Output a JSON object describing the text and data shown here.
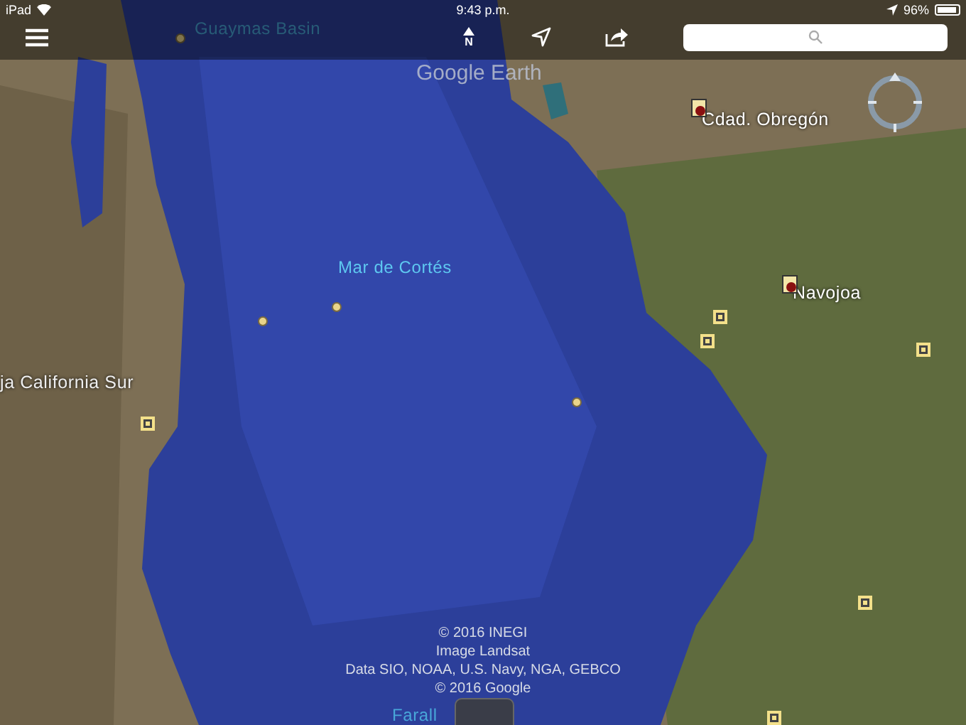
{
  "status_bar": {
    "device": "iPad",
    "time": "9:43 p.m.",
    "battery": "96%"
  },
  "toolbar": {
    "compass_letter": "N"
  },
  "map": {
    "logo": "Google Earth",
    "labels": [
      {
        "kind": "undersea",
        "text": "Guaymas Basin"
      },
      {
        "kind": "city",
        "text": "Cdad. Obregón"
      },
      {
        "kind": "city",
        "text": "Navojoa"
      },
      {
        "kind": "sea",
        "text": "Mar de Cortés"
      },
      {
        "kind": "region",
        "text": "ja California Sur"
      },
      {
        "kind": "undersea",
        "text": "Farall"
      }
    ],
    "markers": [
      {
        "kind": "city"
      },
      {
        "kind": "city"
      },
      {
        "kind": "square"
      },
      {
        "kind": "square"
      },
      {
        "kind": "square"
      },
      {
        "kind": "square"
      },
      {
        "kind": "square"
      },
      {
        "kind": "square"
      },
      {
        "kind": "dot"
      },
      {
        "kind": "dot"
      },
      {
        "kind": "dot"
      },
      {
        "kind": "dot"
      }
    ],
    "attribution": [
      "© 2016 INEGI",
      "Image Landsat",
      "Data SIO, NOAA, U.S. Navy, NGA, GEBCO",
      "© 2016 Google"
    ]
  }
}
